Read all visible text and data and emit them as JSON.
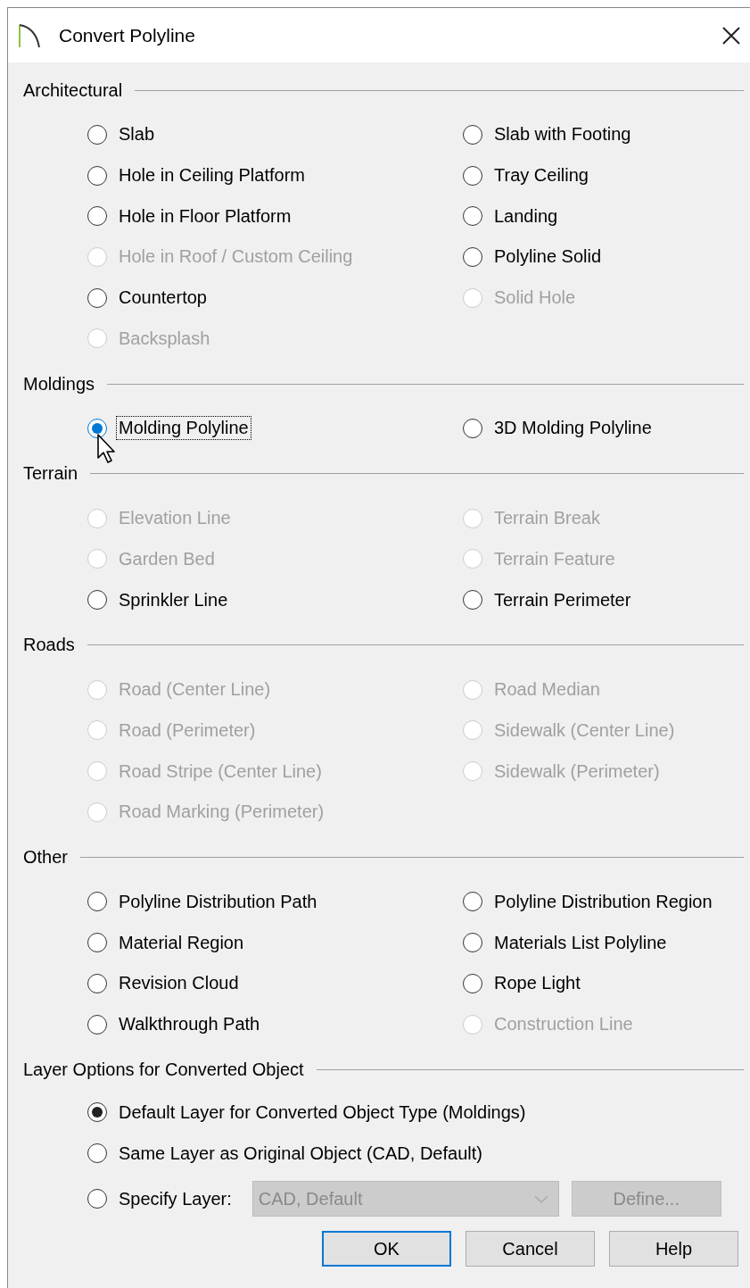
{
  "window": {
    "title": "Convert Polyline"
  },
  "sections": [
    {
      "title": "Architectural",
      "items": [
        {
          "label": "Slab",
          "selected": false,
          "disabled": false,
          "focused": false
        },
        {
          "label": "Slab with Footing",
          "selected": false,
          "disabled": false,
          "focused": false
        },
        {
          "label": "Hole in Ceiling Platform",
          "selected": false,
          "disabled": false,
          "focused": false
        },
        {
          "label": "Tray Ceiling",
          "selected": false,
          "disabled": false,
          "focused": false
        },
        {
          "label": "Hole in Floor Platform",
          "selected": false,
          "disabled": false,
          "focused": false
        },
        {
          "label": "Landing",
          "selected": false,
          "disabled": false,
          "focused": false
        },
        {
          "label": "Hole in Roof / Custom Ceiling",
          "selected": false,
          "disabled": true,
          "focused": false
        },
        {
          "label": "Polyline Solid",
          "selected": false,
          "disabled": false,
          "focused": false
        },
        {
          "label": "Countertop",
          "selected": false,
          "disabled": false,
          "focused": false
        },
        {
          "label": "Solid Hole",
          "selected": false,
          "disabled": true,
          "focused": false
        },
        {
          "label": "Backsplash",
          "selected": false,
          "disabled": true,
          "focused": false
        }
      ]
    },
    {
      "title": "Moldings",
      "items": [
        {
          "label": "Molding Polyline",
          "selected": true,
          "disabled": false,
          "focused": true
        },
        {
          "label": "3D Molding Polyline",
          "selected": false,
          "disabled": false,
          "focused": false
        }
      ]
    },
    {
      "title": "Terrain",
      "items": [
        {
          "label": "Elevation Line",
          "selected": false,
          "disabled": true,
          "focused": false
        },
        {
          "label": "Terrain Break",
          "selected": false,
          "disabled": true,
          "focused": false
        },
        {
          "label": "Garden Bed",
          "selected": false,
          "disabled": true,
          "focused": false
        },
        {
          "label": "Terrain Feature",
          "selected": false,
          "disabled": true,
          "focused": false
        },
        {
          "label": "Sprinkler Line",
          "selected": false,
          "disabled": false,
          "focused": false
        },
        {
          "label": "Terrain Perimeter",
          "selected": false,
          "disabled": false,
          "focused": false
        }
      ]
    },
    {
      "title": "Roads",
      "items": [
        {
          "label": "Road (Center Line)",
          "selected": false,
          "disabled": true,
          "focused": false
        },
        {
          "label": "Road Median",
          "selected": false,
          "disabled": true,
          "focused": false
        },
        {
          "label": "Road (Perimeter)",
          "selected": false,
          "disabled": true,
          "focused": false
        },
        {
          "label": "Sidewalk (Center Line)",
          "selected": false,
          "disabled": true,
          "focused": false
        },
        {
          "label": "Road Stripe (Center Line)",
          "selected": false,
          "disabled": true,
          "focused": false
        },
        {
          "label": "Sidewalk (Perimeter)",
          "selected": false,
          "disabled": true,
          "focused": false
        },
        {
          "label": "Road Marking (Perimeter)",
          "selected": false,
          "disabled": true,
          "focused": false
        }
      ]
    },
    {
      "title": "Other",
      "items": [
        {
          "label": "Polyline Distribution Path",
          "selected": false,
          "disabled": false,
          "focused": false
        },
        {
          "label": "Polyline Distribution Region",
          "selected": false,
          "disabled": false,
          "focused": false
        },
        {
          "label": "Material Region",
          "selected": false,
          "disabled": false,
          "focused": false
        },
        {
          "label": "Materials List Polyline",
          "selected": false,
          "disabled": false,
          "focused": false
        },
        {
          "label": "Revision Cloud",
          "selected": false,
          "disabled": false,
          "focused": false
        },
        {
          "label": "Rope Light",
          "selected": false,
          "disabled": false,
          "focused": false
        },
        {
          "label": "Walkthrough Path",
          "selected": false,
          "disabled": false,
          "focused": false
        },
        {
          "label": "Construction Line",
          "selected": false,
          "disabled": true,
          "focused": false
        }
      ]
    }
  ],
  "layer_options": {
    "title": "Layer Options for Converted Object",
    "options": [
      {
        "label": "Default Layer for Converted Object Type (Moldings)",
        "selected": true
      },
      {
        "label": "Same Layer as Original Object (CAD,  Default)",
        "selected": false
      },
      {
        "label": "Specify Layer:",
        "selected": false
      }
    ],
    "layer_dropdown": {
      "value": "CAD,  Default",
      "disabled": true
    },
    "define_button": {
      "label": "Define...",
      "disabled": true
    }
  },
  "buttons": [
    {
      "label": "OK",
      "default": true
    },
    {
      "label": "Cancel",
      "default": false
    },
    {
      "label": "Help",
      "default": false
    }
  ]
}
